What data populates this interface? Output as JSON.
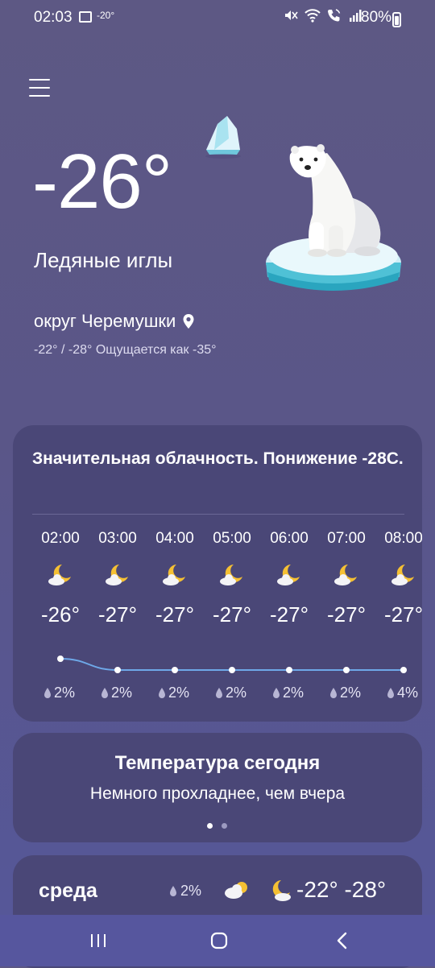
{
  "status_bar": {
    "time": "02:03",
    "temp_badge": "-20°",
    "battery": "80%",
    "icons": [
      "image-icon",
      "mute-icon",
      "wifi-icon",
      "call-icon",
      "signal-icon",
      "battery-icon"
    ]
  },
  "current": {
    "temperature": "-26°",
    "condition": "Ледяные иглы",
    "location": "округ Черемушки",
    "feels": "-22° / -28° Ощущается как -35°"
  },
  "hourly": {
    "summary": "Значительная облачность. Понижение -28С.",
    "items": [
      {
        "time": "02:00",
        "temp": "-26°",
        "precip": "2%",
        "icon": "moon-cloud-icon"
      },
      {
        "time": "03:00",
        "temp": "-27°",
        "precip": "2%",
        "icon": "moon-cloud-icon"
      },
      {
        "time": "04:00",
        "temp": "-27°",
        "precip": "2%",
        "icon": "moon-cloud-icon"
      },
      {
        "time": "05:00",
        "temp": "-27°",
        "precip": "2%",
        "icon": "moon-cloud-icon"
      },
      {
        "time": "06:00",
        "temp": "-27°",
        "precip": "2%",
        "icon": "moon-cloud-icon"
      },
      {
        "time": "07:00",
        "temp": "-27°",
        "precip": "2%",
        "icon": "moon-cloud-icon"
      },
      {
        "time": "08:00",
        "temp": "-27°",
        "precip": "4%",
        "icon": "moon-cloud-icon"
      }
    ]
  },
  "today_card": {
    "title": "Температура сегодня",
    "subtitle": "Немного прохладнее, чем вчера"
  },
  "daily": {
    "day": "среда",
    "precip": "2%",
    "temps": "-22° -28°"
  },
  "colors": {
    "background": "#5b5787",
    "card": "#4a4777",
    "accent_moon": "#f5c033",
    "line": "#6ea8e8"
  }
}
